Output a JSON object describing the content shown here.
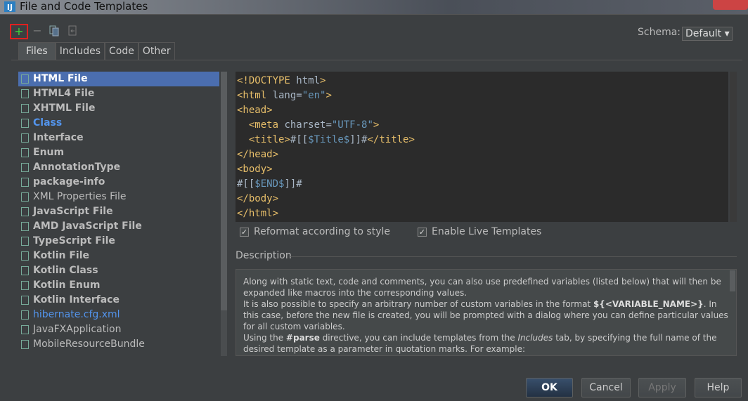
{
  "window": {
    "title": "File and Code Templates",
    "icon": "intellij-icon"
  },
  "toolbar": {
    "add": "+",
    "remove": "−",
    "copy_icon": "copy-icon",
    "reset_icon": "reset-icon"
  },
  "schema": {
    "label": "Schema:",
    "value": "Default"
  },
  "tabs": [
    {
      "label": "Files",
      "active": true
    },
    {
      "label": "Includes"
    },
    {
      "label": "Code"
    },
    {
      "label": "Other"
    }
  ],
  "templates": [
    {
      "label": "HTML File",
      "selected": true
    },
    {
      "label": "HTML4 File"
    },
    {
      "label": "XHTML File"
    },
    {
      "label": "Class",
      "style": "link"
    },
    {
      "label": "Interface"
    },
    {
      "label": "Enum"
    },
    {
      "label": "AnnotationType"
    },
    {
      "label": "package-info"
    },
    {
      "label": "XML Properties File",
      "style": "normal"
    },
    {
      "label": "JavaScript File"
    },
    {
      "label": "AMD JavaScript File"
    },
    {
      "label": "TypeScript File"
    },
    {
      "label": "Kotlin File"
    },
    {
      "label": "Kotlin Class"
    },
    {
      "label": "Kotlin Enum"
    },
    {
      "label": "Kotlin Interface"
    },
    {
      "label": "hibernate.cfg.xml",
      "style": "link-normal"
    },
    {
      "label": "JavaFXApplication",
      "style": "normal"
    },
    {
      "label": "MobileResourceBundle",
      "style": "normal"
    }
  ],
  "editor": {
    "lines": [
      "<!DOCTYPE html>",
      "<html lang=\"en\">",
      "<head>",
      "  <meta charset=\"UTF-8\">",
      "  <title>#[[$Title$]]#</title>",
      "</head>",
      "<body>",
      "#[[$END$]]#",
      "</body>",
      "</html>"
    ]
  },
  "options": {
    "reformat": {
      "label": "Reformat according to style",
      "checked": true
    },
    "live": {
      "label": "Enable Live Templates",
      "checked": true
    }
  },
  "description": {
    "label": "Description",
    "p1": "Along with static text, code and comments, you can also use predefined variables (listed below) that will then be expanded like macros into the corresponding values.",
    "p2a": "It is also possible to specify an arbitrary number of custom variables in the format ",
    "p2b": "${<VARIABLE_NAME>}",
    "p2c": ". In this case, before the new file is created, you will be prompted with a dialog where you can define particular values for all custom variables.",
    "p3a": "Using the ",
    "p3b": "#parse",
    "p3c": " directive, you can include templates from the ",
    "p3d": "Includes",
    "p3e": " tab, by specifying the full name of the desired template as a parameter in quotation marks. For example:"
  },
  "buttons": {
    "ok": "OK",
    "cancel": "Cancel",
    "apply": "Apply",
    "help": "Help"
  }
}
